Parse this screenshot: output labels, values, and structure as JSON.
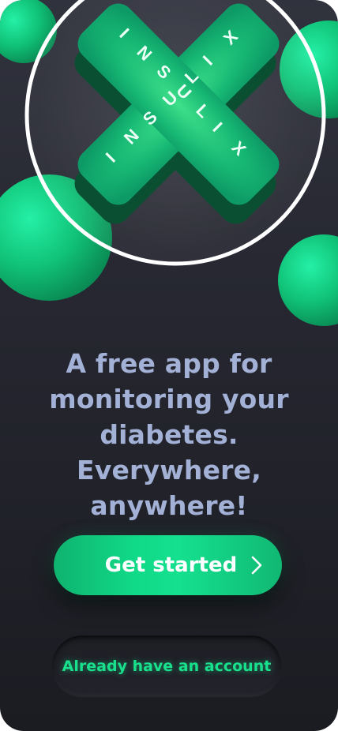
{
  "brand": {
    "logo_text": "INSULIX",
    "accent": "#13d88a",
    "background": "#2a2b34"
  },
  "hero": {
    "headline": "A free app for monitoring your diabetes. Everywhere, anywhere!"
  },
  "actions": {
    "primary_label": "Get started",
    "primary_icon": "chevron-right-icon",
    "secondary_label": "Already have an account"
  }
}
